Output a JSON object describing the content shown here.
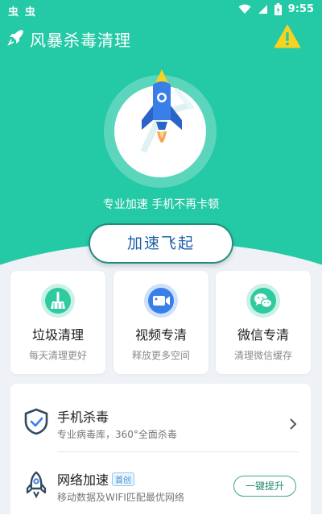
{
  "status_bar": {
    "left_glyphs": [
      "虫",
      "虫"
    ],
    "time": "9:55",
    "icons": [
      "wifi-icon",
      "signal-icon",
      "battery-icon"
    ]
  },
  "app_bar": {
    "title": "风暴杀毒清理",
    "icons": [
      "rocket-logo-icon",
      "warning-icon"
    ]
  },
  "hero": {
    "tagline": "专业加速 手机不再卡顿",
    "speed_button": "加速飞起"
  },
  "cards": [
    {
      "title": "垃圾清理",
      "subtitle": "每天清理更好",
      "icon": "broom-icon",
      "color": "#2fcaa0"
    },
    {
      "title": "视频专清",
      "subtitle": "释放更多空间",
      "icon": "video-icon",
      "color": "#3a7fe8"
    },
    {
      "title": "微信专清",
      "subtitle": "清理微信缓存",
      "icon": "wechat-icon",
      "color": "#2fcaa0"
    }
  ],
  "list": [
    {
      "title": "手机杀毒",
      "subtitle": "专业病毒库，360°全面杀毒",
      "icon": "shield-icon"
    },
    {
      "title": "网络加速",
      "badge": "首创",
      "subtitle": "移动数据及WIFI匹配最优网络",
      "icon": "rocket-outline-icon",
      "action": "一键提升"
    }
  ],
  "colors": {
    "brand": "#24c9a6",
    "accent_blue": "#1e5fa9",
    "background": "#eef1f5"
  }
}
